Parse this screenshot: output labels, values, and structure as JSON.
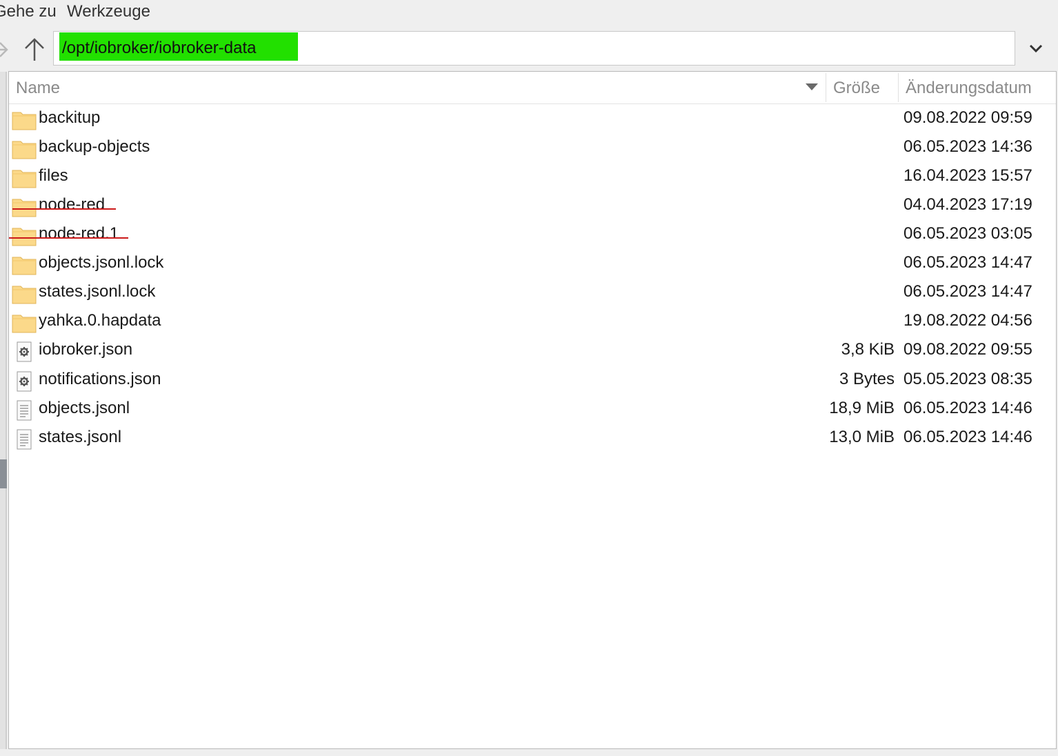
{
  "menu": {
    "items": [
      {
        "label": "Gehe zu"
      },
      {
        "label": "Werkzeuge"
      }
    ]
  },
  "toolbar": {
    "path": "/opt/iobroker/iobroker-data",
    "icons": [
      "forward-arrow-icon",
      "up-arrow-icon",
      "chevron-down-icon"
    ],
    "highlight_color": "#22e000"
  },
  "columns": {
    "name": "Name",
    "size": "Größe",
    "date": "Änderungsdatum"
  },
  "files": [
    {
      "name": "backitup",
      "type": "folder",
      "size": "",
      "date": "09.08.2022 09:59",
      "struck": false
    },
    {
      "name": "backup-objects",
      "type": "folder",
      "size": "",
      "date": "06.05.2023 14:36",
      "struck": false
    },
    {
      "name": "files",
      "type": "folder",
      "size": "",
      "date": "16.04.2023 15:57",
      "struck": false
    },
    {
      "name": "node-red",
      "type": "folder",
      "size": "",
      "date": "04.04.2023 17:19",
      "struck": true
    },
    {
      "name": "node-red.1",
      "type": "folder",
      "size": "",
      "date": "06.05.2023 03:05",
      "struck": true
    },
    {
      "name": "objects.jsonl.lock",
      "type": "folder",
      "size": "",
      "date": "06.05.2023 14:47",
      "struck": false
    },
    {
      "name": "states.jsonl.lock",
      "type": "folder",
      "size": "",
      "date": "06.05.2023 14:47",
      "struck": false
    },
    {
      "name": "yahka.0.hapdata",
      "type": "folder",
      "size": "",
      "date": "19.08.2022 04:56",
      "struck": false
    },
    {
      "name": "iobroker.json",
      "type": "config",
      "size": "3,8 KiB",
      "date": "09.08.2022 09:55",
      "struck": false
    },
    {
      "name": "notifications.json",
      "type": "config",
      "size": "3 Bytes",
      "date": "05.05.2023 08:35",
      "struck": false
    },
    {
      "name": "objects.jsonl",
      "type": "text",
      "size": "18,9 MiB",
      "date": "06.05.2023 14:46",
      "struck": false
    },
    {
      "name": "states.jsonl",
      "type": "text",
      "size": "13,0 MiB",
      "date": "06.05.2023 14:46",
      "struck": false
    }
  ],
  "colors": {
    "folder": "#fbd98a",
    "strike": "#cc1a1a"
  }
}
